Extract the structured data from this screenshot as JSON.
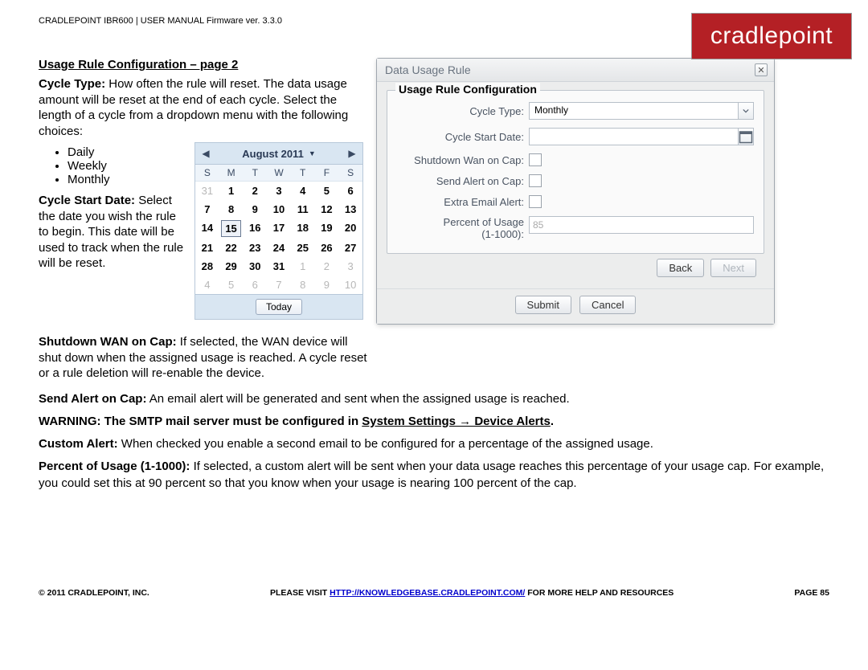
{
  "brand": "cradlepoint",
  "header": "CRADLEPOINT IBR600 | USER MANUAL Firmware ver. 3.3.0",
  "section_title": "Usage Rule Configuration – page 2",
  "cycle_type_label": "Cycle Type:",
  "cycle_type_text": " How often the rule will reset. The data usage amount will be reset at the end of each cycle. Select the length of a cycle from a dropdown menu with the following choices:",
  "bullets": [
    "Daily",
    "Weekly",
    "Monthly"
  ],
  "csd_label": "Cycle Start Date:",
  "csd_text": " Select the date you wish the rule to begin. This date will be used to track when the rule will be reset.",
  "shutdown_label": "Shutdown WAN on Cap:",
  "shutdown_text": " If selected, the WAN device will shut down when the assigned usage is reached. A cycle reset or a rule deletion will re-enable the device.",
  "send_alert_label": "Send Alert on Cap:",
  "send_alert_text": " An email alert will be generated and sent when the assigned usage is reached.",
  "warning_prefix": "WARNING: The SMTP mail server must be configured in ",
  "warning_link": "System Settings → Device Alerts",
  "warning_suffix": ".",
  "custom_alert_label": "Custom Alert:",
  "custom_alert_text": " When checked you enable a second email to be configured for a percentage of the assigned usage.",
  "pou_label": "Percent of Usage (1-1000):",
  "pou_text": " If selected, a custom alert will be sent when your data usage reaches this percentage of your usage cap. For example, you could set this at 90 percent so that you know when your usage is nearing 100 percent of the cap.",
  "calendar": {
    "title": "August 2011",
    "dow": [
      "S",
      "M",
      "T",
      "W",
      "T",
      "F",
      "S"
    ],
    "rows": [
      [
        {
          "d": "31",
          "o": true
        },
        {
          "d": "1"
        },
        {
          "d": "2"
        },
        {
          "d": "3"
        },
        {
          "d": "4"
        },
        {
          "d": "5"
        },
        {
          "d": "6"
        }
      ],
      [
        {
          "d": "7"
        },
        {
          "d": "8"
        },
        {
          "d": "9"
        },
        {
          "d": "10"
        },
        {
          "d": "11"
        },
        {
          "d": "12"
        },
        {
          "d": "13"
        }
      ],
      [
        {
          "d": "14"
        },
        {
          "d": "15",
          "sel": true
        },
        {
          "d": "16"
        },
        {
          "d": "17"
        },
        {
          "d": "18"
        },
        {
          "d": "19"
        },
        {
          "d": "20"
        }
      ],
      [
        {
          "d": "21"
        },
        {
          "d": "22"
        },
        {
          "d": "23"
        },
        {
          "d": "24"
        },
        {
          "d": "25"
        },
        {
          "d": "26"
        },
        {
          "d": "27"
        }
      ],
      [
        {
          "d": "28"
        },
        {
          "d": "29"
        },
        {
          "d": "30"
        },
        {
          "d": "31"
        },
        {
          "d": "1",
          "o": true
        },
        {
          "d": "2",
          "o": true
        },
        {
          "d": "3",
          "o": true
        }
      ],
      [
        {
          "d": "4",
          "o": true
        },
        {
          "d": "5",
          "o": true
        },
        {
          "d": "6",
          "o": true
        },
        {
          "d": "7",
          "o": true
        },
        {
          "d": "8",
          "o": true
        },
        {
          "d": "9",
          "o": true
        },
        {
          "d": "10",
          "o": true
        }
      ]
    ],
    "today": "Today"
  },
  "dialog": {
    "title": "Data Usage Rule",
    "legend": "Usage Rule Configuration",
    "cycle_type_label": "Cycle Type:",
    "cycle_type_value": "Monthly",
    "cycle_start_label": "Cycle Start Date:",
    "shutdown_label": "Shutdown Wan on Cap:",
    "send_alert_label": "Send Alert on Cap:",
    "extra_email_label": "Extra Email Alert:",
    "pou_label_1": "Percent of Usage",
    "pou_label_2": "(1-1000):",
    "pou_value": "85",
    "back": "Back",
    "next": "Next",
    "submit": "Submit",
    "cancel": "Cancel"
  },
  "footer": {
    "left": "© 2011 CRADLEPOINT, INC.",
    "mid_pre": "PLEASE VISIT ",
    "mid_link": "HTTP://KNOWLEDGEBASE.CRADLEPOINT.COM/",
    "mid_post": " FOR MORE HELP AND RESOURCES",
    "right": "PAGE 85"
  }
}
